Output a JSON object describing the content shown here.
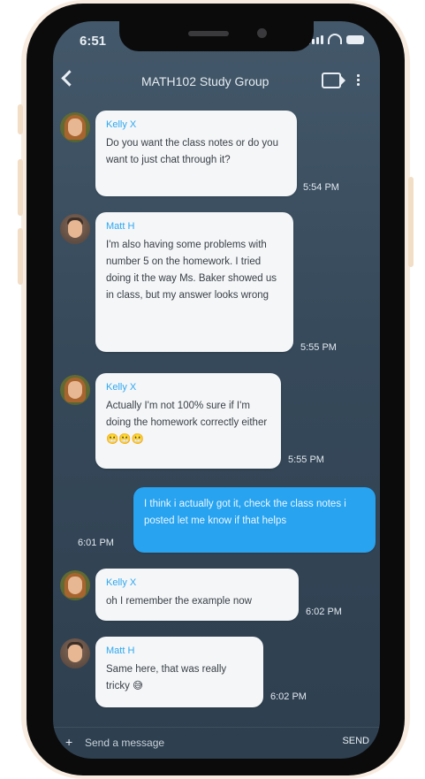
{
  "status_bar": {
    "time": "6:51"
  },
  "header": {
    "title": "MATH102 Study Group"
  },
  "icons": {
    "back": "back-chevron-icon",
    "video": "video-camera-icon",
    "menu": "more-vertical-icon",
    "attach": "plus-icon"
  },
  "messages": [
    {
      "sender": "Kelly X",
      "text": "Do you want the class notes or do you want to just chat through it?",
      "time": "5:54 PM"
    },
    {
      "sender": "Matt H",
      "text": "I'm also having some problems with number 5 on the homework. I tried doing it the way Ms. Baker showed us in class, but my answer looks wrong",
      "time": "5:55 PM"
    },
    {
      "sender": "Kelly X",
      "text": "Actually I'm not 100% sure if I'm doing the homework correctly either 😬😬😬",
      "time": "5:55 PM"
    },
    {
      "sender": "",
      "text": "I think i actually got it, check the class notes i posted let me know if that helps",
      "time": "6:01 PM"
    },
    {
      "sender": "Kelly X",
      "text": "oh I remember the example now",
      "time": "6:02 PM"
    },
    {
      "sender": "Matt H",
      "text": "Same here, that was really tricky 😅",
      "time": "6:02 PM"
    }
  ],
  "composer": {
    "placeholder": "Send a message",
    "send_label": "SEND"
  },
  "colors": {
    "accent": "#2fa8f0",
    "my_bubble": "#27a3f0",
    "background": "#3a4d5e"
  }
}
